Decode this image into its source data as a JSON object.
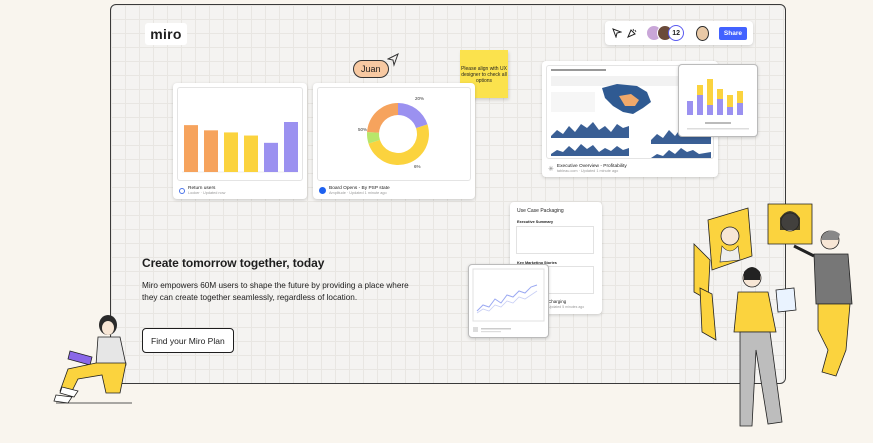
{
  "header": {
    "logo": "miro",
    "share_label": "Share",
    "collaborator_count": "12"
  },
  "cursor": {
    "name": "Juan"
  },
  "sticky_note": {
    "text": "Please align with UX designer to check all options"
  },
  "cards": {
    "return_users": {
      "title": "Return users",
      "sub": "Looker  ·  Updated now",
      "chart_data": {
        "type": "bar",
        "values": [
          45,
          40,
          38,
          35,
          28,
          48
        ],
        "colors": [
          "#f6a35d",
          "#f6a35d",
          "#fbd33e",
          "#fbd33e",
          "#9b91f0",
          "#9b91f0"
        ]
      }
    },
    "board_opens": {
      "title": "Board Opens - By PSP state",
      "sub": "Amplitude  ·  Updated 1 minute ago",
      "chart_data": {
        "type": "pie",
        "labels": [
          "20%",
          "50%",
          "6%"
        ],
        "values": [
          20,
          50,
          6,
          24
        ],
        "colors": [
          "#9b91f0",
          "#fbd33e",
          "#b8e66a",
          "#f6a35d"
        ]
      }
    },
    "exec_overview": {
      "title": "Executive Overview - Profitability",
      "sub": "tableau.com  ·  Updated 1 minute ago"
    },
    "use_case": {
      "title": "Use Case Packaging",
      "section1": "Executive Summary",
      "section2": "Key Marketing Stories",
      "footer": "Charging",
      "footer_sub": "Updated 5 minutes ago"
    }
  },
  "hero": {
    "title": "Create tomorrow together, today",
    "body": "Miro empowers 60M users to shape the future by providing a place where they can create together seamlessly, regardless of location.",
    "cta": "Find your Miro Plan"
  },
  "colors": {
    "accent": "#4262ff",
    "sticky": "#fbe24d",
    "yellow": "#fbd33e",
    "orange": "#f6a35d",
    "purple": "#9b91f0"
  }
}
